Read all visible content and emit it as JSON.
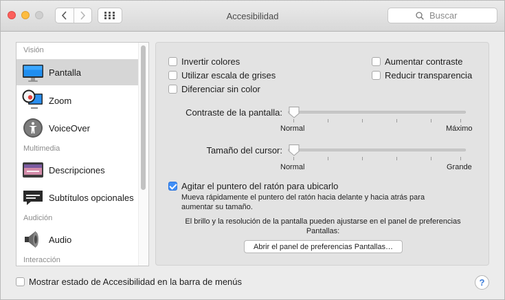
{
  "window": {
    "title": "Accesibilidad"
  },
  "search": {
    "placeholder": "Buscar"
  },
  "sidebar": {
    "sections": [
      {
        "label": "Visión"
      },
      {
        "label": "Multimedia"
      },
      {
        "label": "Audición"
      },
      {
        "label": "Interacción"
      }
    ],
    "items": [
      {
        "label": "Pantalla",
        "icon": "display-icon",
        "selected": true
      },
      {
        "label": "Zoom",
        "icon": "zoom-icon"
      },
      {
        "label": "VoiceOver",
        "icon": "voiceover-icon"
      },
      {
        "label": "Descripciones",
        "icon": "descriptions-icon"
      },
      {
        "label": "Subtítulos opcionales",
        "icon": "captions-icon"
      },
      {
        "label": "Audio",
        "icon": "speaker-icon"
      }
    ]
  },
  "display": {
    "checkboxes": [
      {
        "label": "Invertir colores",
        "checked": false
      },
      {
        "label": "Utilizar escala de grises",
        "checked": false
      },
      {
        "label": "Diferenciar sin color",
        "checked": false
      },
      {
        "label": "Aumentar contraste",
        "checked": false
      },
      {
        "label": "Reducir transparencia",
        "checked": false
      }
    ],
    "contrast": {
      "label": "Contraste de la pantalla:",
      "min_label": "Normal",
      "max_label": "Máximo",
      "value": 0
    },
    "cursor": {
      "label": "Tamaño del cursor:",
      "min_label": "Normal",
      "max_label": "Grande",
      "value": 0
    },
    "shake": {
      "label": "Agitar el puntero del ratón para ubicarlo",
      "checked": true,
      "description_line1": "Mueva rápidamente el puntero del ratón hacia delante y hacia atrás para",
      "description_line2": "aumentar su tamaño."
    },
    "note_line1": "El brillo y la resolución de la pantalla pueden ajustarse en el panel de preferencias",
    "note_line2": "Pantallas:",
    "open_button": "Abrir el panel de preferencias Pantallas…"
  },
  "footer": {
    "menu_status_label": "Mostrar estado de Accesibilidad en la barra de menús",
    "menu_status_checked": false,
    "help": "?"
  },
  "colors": {
    "accent": "#3f8ef6",
    "selected_row": "#d6d6d6"
  }
}
